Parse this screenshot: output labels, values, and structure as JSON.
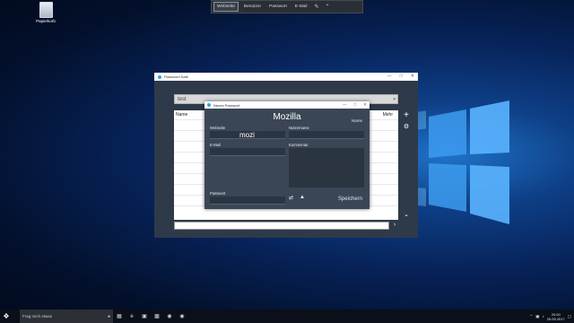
{
  "desktop": {
    "icon_label": "Papierkorb"
  },
  "toolbar": {
    "tabs": [
      "Webseite",
      "Benutzer",
      "Passwort",
      "E-Mail"
    ],
    "active_tab": "Webseite",
    "icons": [
      "paste-icon",
      "collapse-icon"
    ]
  },
  "back_window": {
    "title": "Password Safe",
    "search_value": "test",
    "col_name": "Name",
    "col_right": "Mehr"
  },
  "dialog": {
    "title": "Neues Passwort",
    "heading": "Mozilla",
    "name_label": "Name",
    "fields": {
      "website_label": "Webseite",
      "website_value": "mozi",
      "username_label": "Nutzername",
      "email_label": "E-Mail",
      "comment_label": "Kommentar",
      "password_label": "Passwort"
    },
    "save_label": "Speichern"
  },
  "taskbar": {
    "search_placeholder": "Frag mich etwas",
    "time": "20:00",
    "date": "25.05.2017"
  }
}
